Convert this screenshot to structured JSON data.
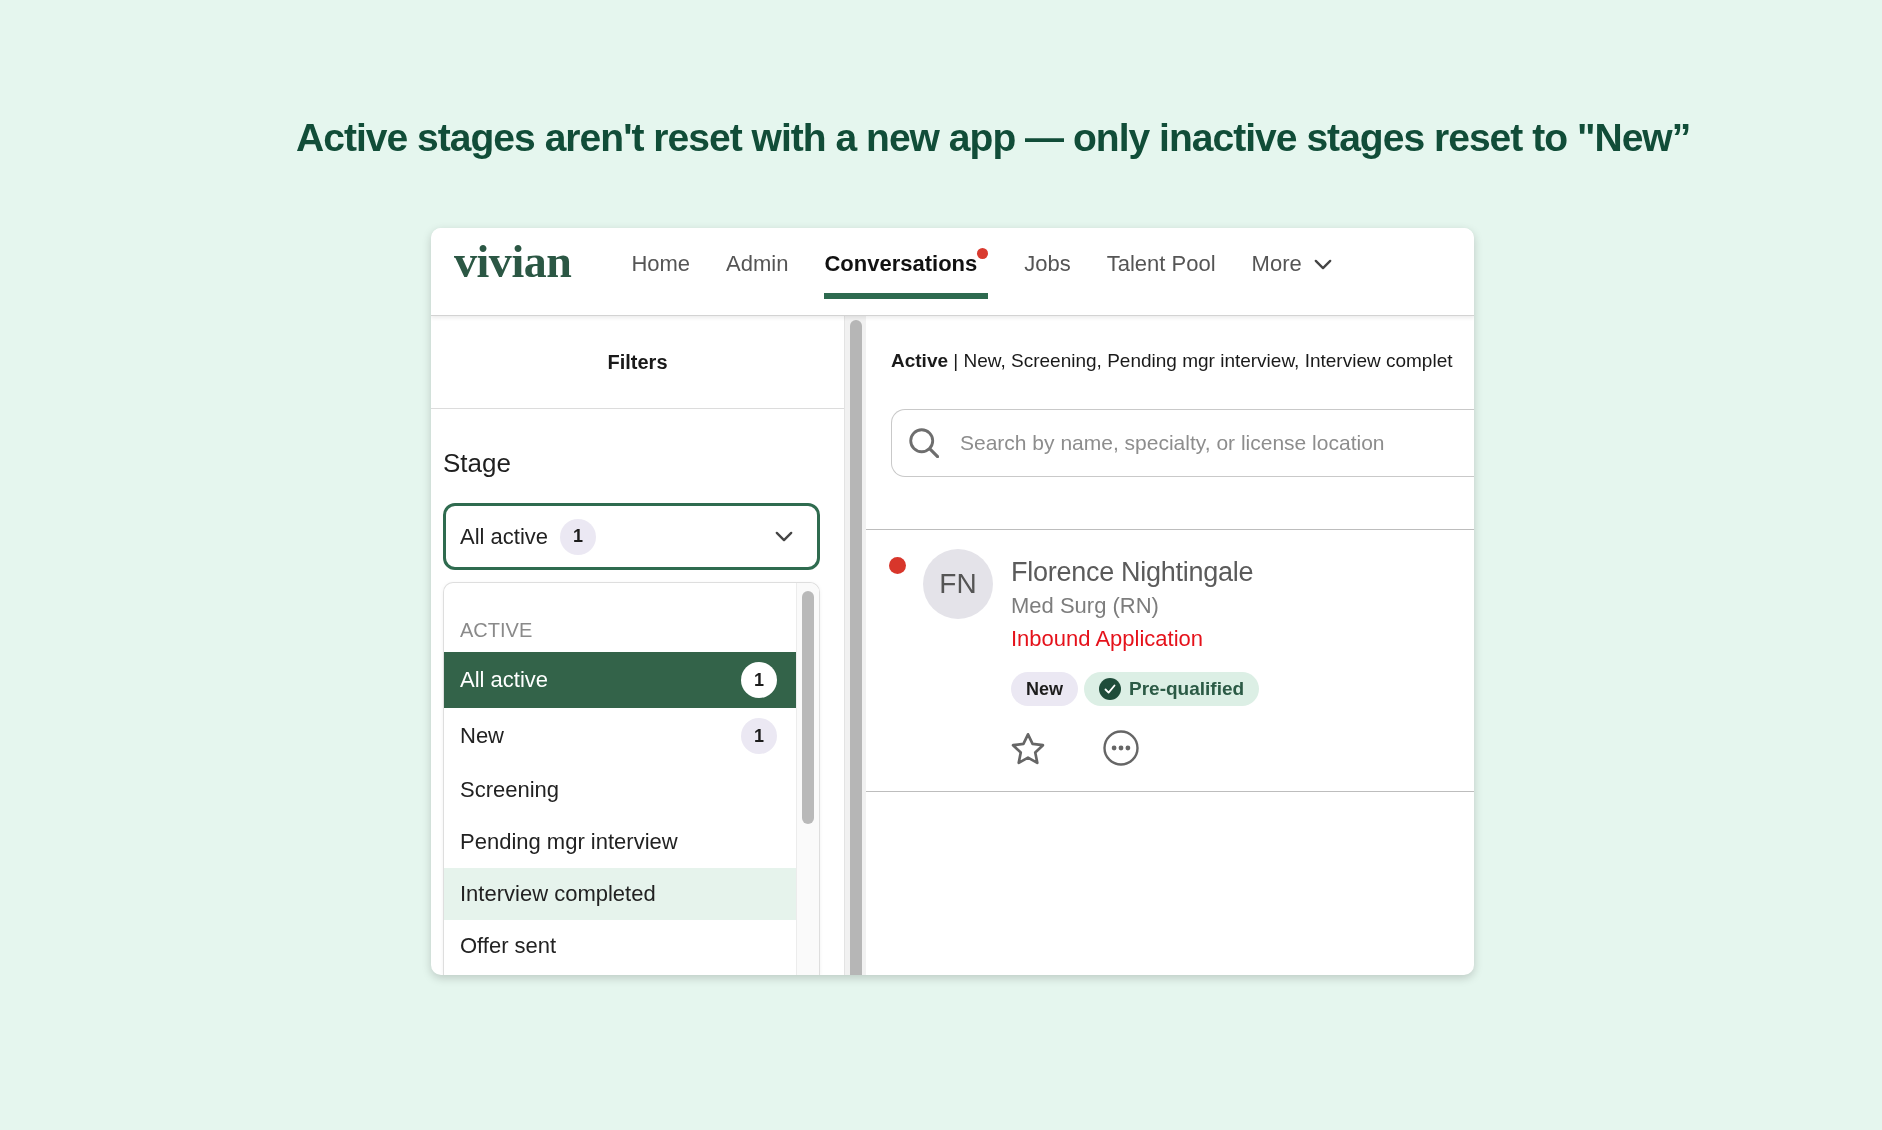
{
  "headline": "Active stages aren't reset with a new app — only inactive stages reset to \"New”",
  "app": {
    "logo": "vivian",
    "nav": [
      {
        "label": "Home",
        "kind": "link",
        "selected": false,
        "notification": false
      },
      {
        "label": "Admin",
        "kind": "link",
        "selected": false,
        "notification": false
      },
      {
        "label": "Conversations",
        "kind": "link",
        "selected": true,
        "notification": true
      },
      {
        "label": "Jobs",
        "kind": "link",
        "selected": false,
        "notification": false
      },
      {
        "label": "Talent Pool",
        "kind": "link",
        "selected": false,
        "notification": false
      },
      {
        "label": "More",
        "kind": "menu",
        "selected": false,
        "notification": false
      }
    ],
    "filters": {
      "title": "Filters",
      "stage": {
        "label": "Stage",
        "value": "All active",
        "count": "1",
        "open": true
      },
      "menu": {
        "group": "ACTIVE",
        "items": [
          {
            "label": "All active",
            "count": "1",
            "selected": true,
            "highlighted": false
          },
          {
            "label": "New",
            "count": "1",
            "selected": false,
            "highlighted": false
          },
          {
            "label": "Screening",
            "selected": false,
            "highlighted": false
          },
          {
            "label": "Pending mgr interview",
            "selected": false,
            "highlighted": false
          },
          {
            "label": "Interview completed",
            "selected": false,
            "highlighted": true
          },
          {
            "label": "Offer sent",
            "selected": false,
            "highlighted": false
          }
        ]
      }
    },
    "results": {
      "summary": "**Active** | New, Screening, Pending mgr interview, Interview complet",
      "search": {
        "placeholder": "Search by name, specialty, or license location"
      },
      "candidates": [
        {
          "unread": true,
          "initials": "FN",
          "name": "Florence Nightingale",
          "role": "Med Surg (RN)",
          "source": "Inbound Application",
          "tags": [
            {
              "label": "New",
              "kind": "stage"
            },
            {
              "label": "Pre-qualified",
              "kind": "check"
            }
          ],
          "starred": false
        }
      ]
    }
  }
}
